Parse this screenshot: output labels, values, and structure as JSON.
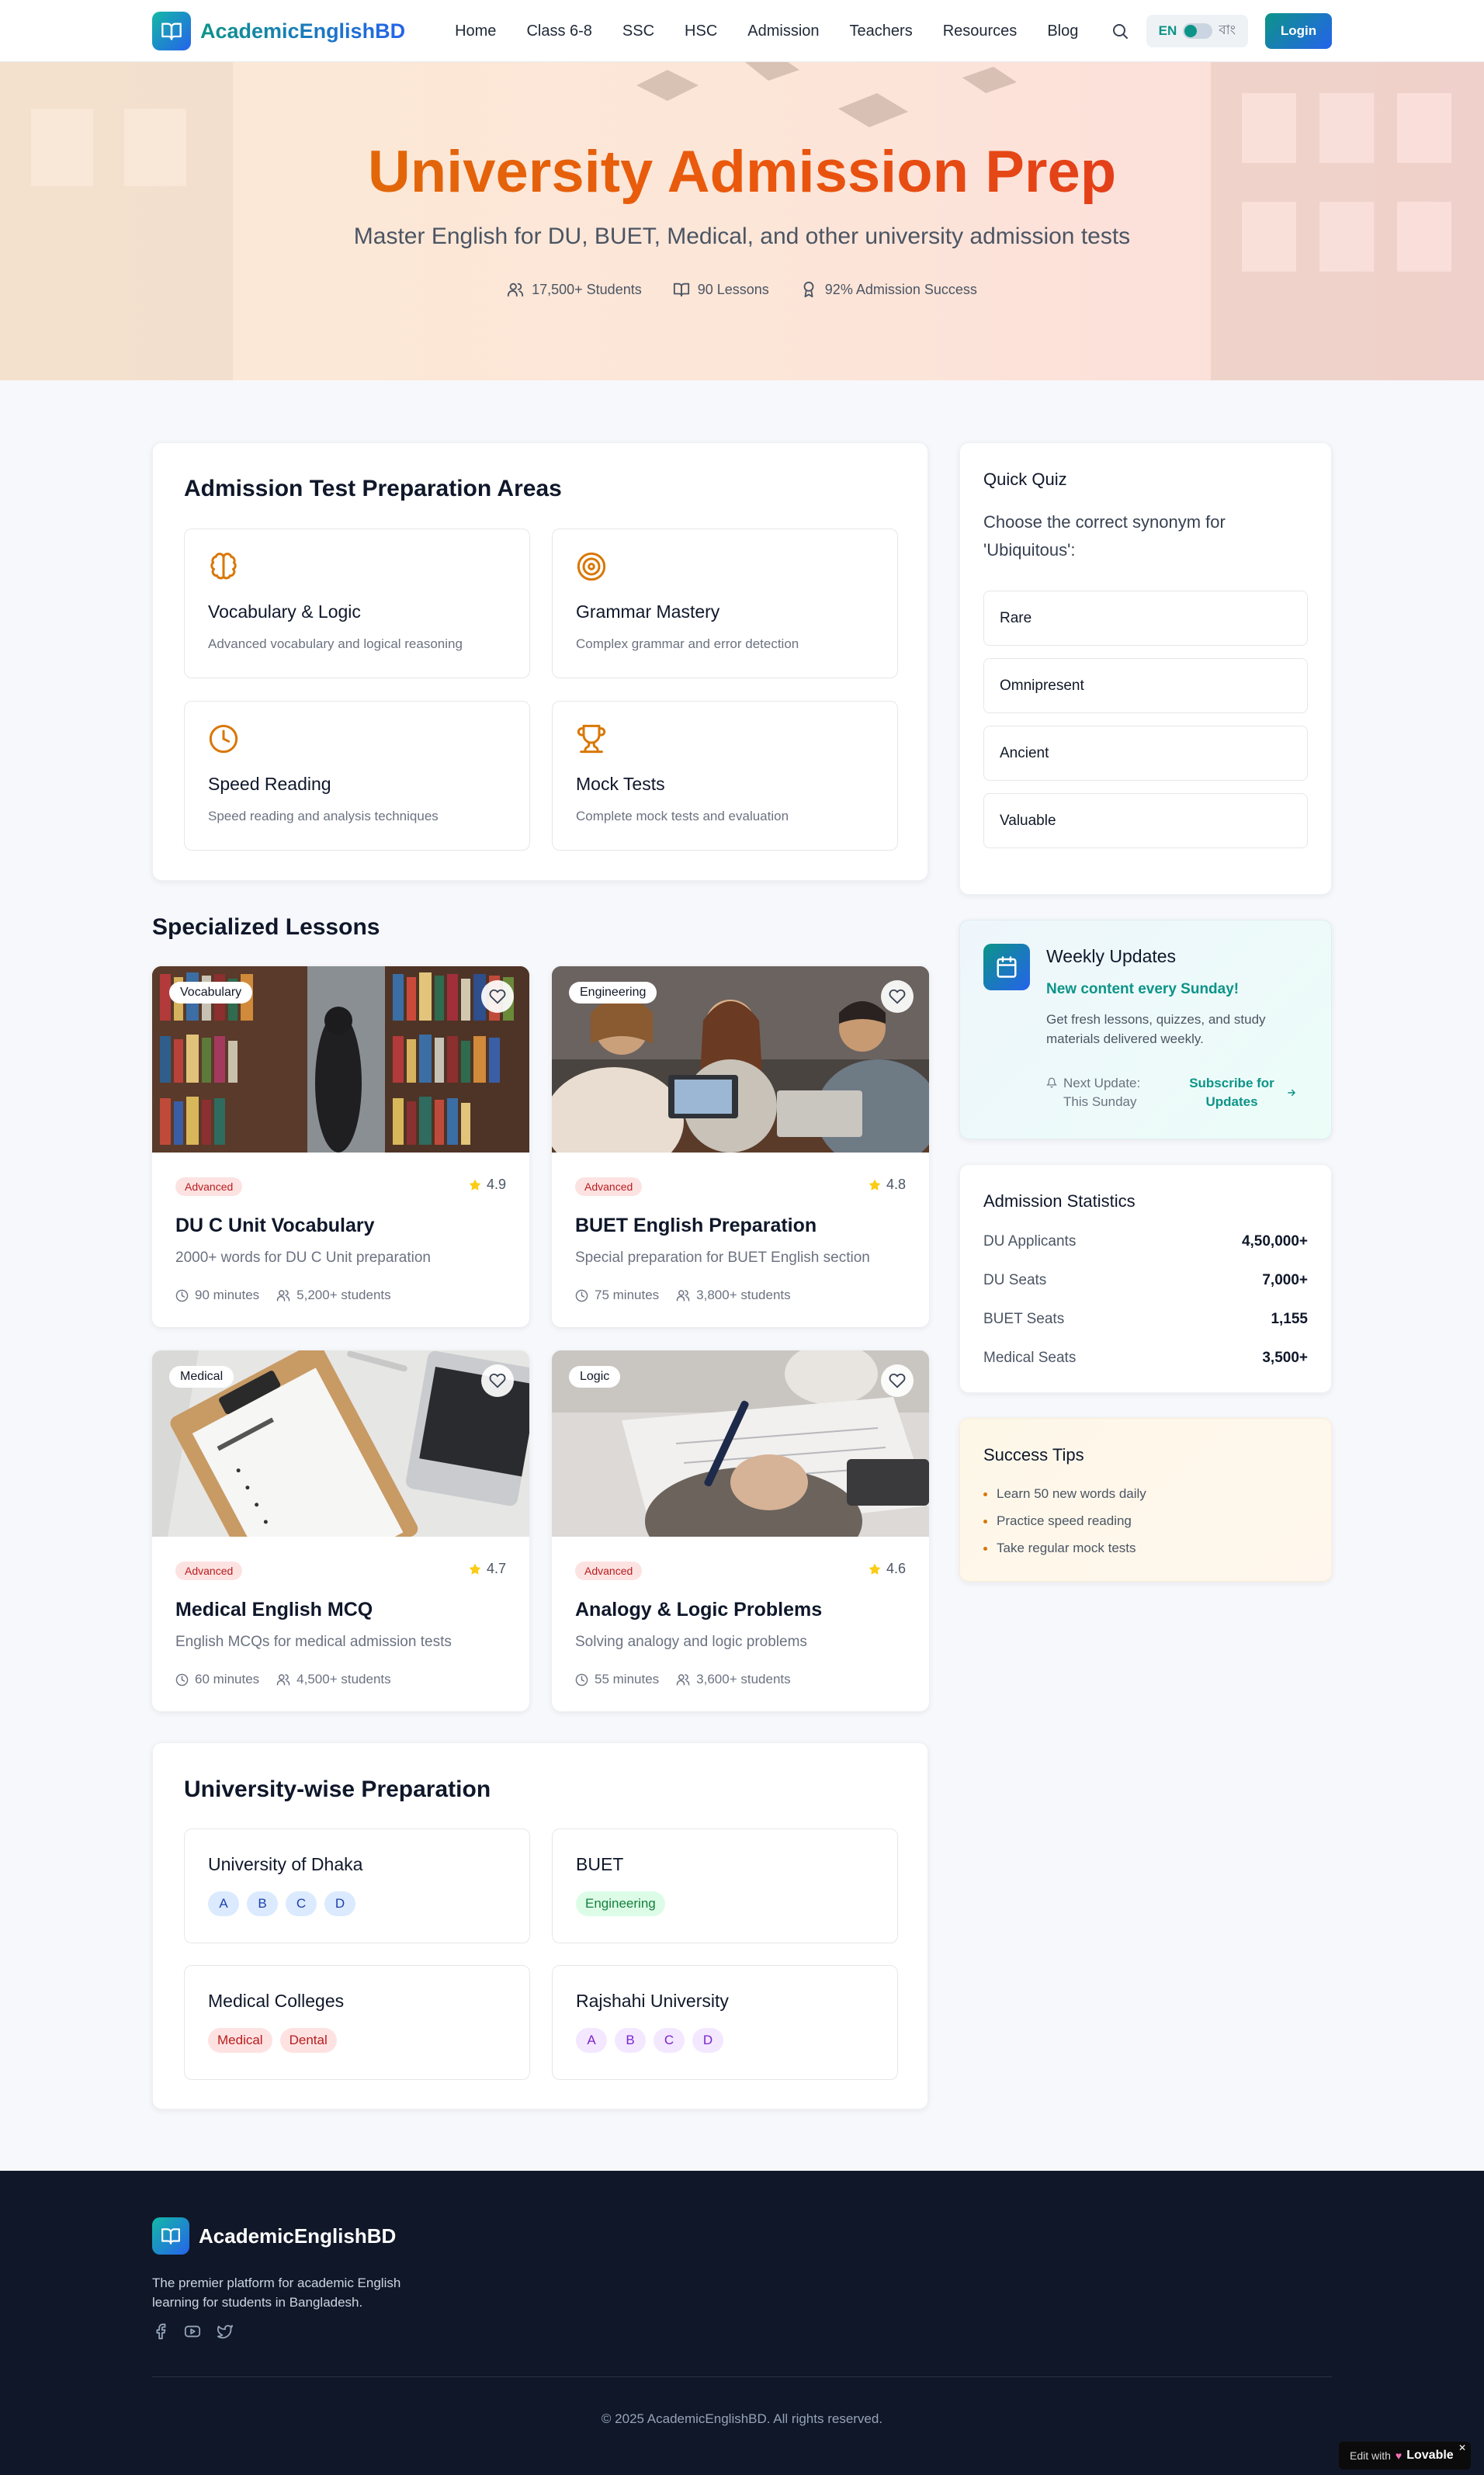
{
  "nav": {
    "brand": "AcademicEnglishBD",
    "links": [
      "Home",
      "Class 6-8",
      "SSC",
      "HSC",
      "Admission",
      "Teachers",
      "Resources",
      "Blog"
    ],
    "lang_en": "EN",
    "lang_bn": "বাং",
    "login": "Login"
  },
  "hero": {
    "title": "University Admission Prep",
    "subtitle": "Master English for DU, BUET, Medical, and other university admission tests",
    "stats": {
      "students": "17,500+ Students",
      "lessons": "90 Lessons",
      "success": "92% Admission Success"
    }
  },
  "areas": {
    "title": "Admission Test Preparation Areas",
    "items": [
      {
        "title": "Vocabulary & Logic",
        "desc": "Advanced vocabulary and logical reasoning",
        "icon": "brain-icon"
      },
      {
        "title": "Grammar Mastery",
        "desc": "Complex grammar and error detection",
        "icon": "target-icon"
      },
      {
        "title": "Speed Reading",
        "desc": "Speed reading and analysis techniques",
        "icon": "clock-icon"
      },
      {
        "title": "Mock Tests",
        "desc": "Complete mock tests and evaluation",
        "icon": "trophy-icon"
      }
    ]
  },
  "lessons": {
    "title": "Specialized Lessons",
    "items": [
      {
        "tag": "Vocabulary",
        "level": "Advanced",
        "rating": "4.9",
        "title": "DU C Unit Vocabulary",
        "desc": "2000+ words for DU C Unit preparation",
        "duration": "90 minutes",
        "students": "5,200+ students"
      },
      {
        "tag": "Engineering",
        "level": "Advanced",
        "rating": "4.8",
        "title": "BUET English Preparation",
        "desc": "Special preparation for BUET English section",
        "duration": "75 minutes",
        "students": "3,800+ students"
      },
      {
        "tag": "Medical",
        "level": "Advanced",
        "rating": "4.7",
        "title": "Medical English MCQ",
        "desc": "English MCQs for medical admission tests",
        "duration": "60 minutes",
        "students": "4,500+ students"
      },
      {
        "tag": "Logic",
        "level": "Advanced",
        "rating": "4.6",
        "title": "Analogy & Logic Problems",
        "desc": "Solving analogy and logic problems",
        "duration": "55 minutes",
        "students": "3,600+ students"
      }
    ]
  },
  "universities": {
    "title": "University-wise Preparation",
    "items": [
      {
        "name": "University of Dhaka",
        "pills": [
          "A",
          "B",
          "C",
          "D"
        ]
      },
      {
        "name": "BUET",
        "pills": [
          "Engineering"
        ]
      },
      {
        "name": "Medical Colleges",
        "pills": [
          "Medical",
          "Dental"
        ]
      },
      {
        "name": "Rajshahi University",
        "pills": [
          "A",
          "B",
          "C",
          "D"
        ]
      }
    ]
  },
  "quiz": {
    "title": "Quick Quiz",
    "question": "Choose the correct synonym for 'Ubiquitous':",
    "options": [
      "Rare",
      "Omnipresent",
      "Ancient",
      "Valuable"
    ]
  },
  "weekly": {
    "title": "Weekly Updates",
    "headline": "New content every Sunday!",
    "desc": "Get fresh lessons, quizzes, and study materials delivered weekly.",
    "next_label": "Next Update:",
    "next_value": "This Sunday",
    "subscribe": "Subscribe for Updates"
  },
  "stats": {
    "title": "Admission Statistics",
    "rows": [
      {
        "label": "DU Applicants",
        "value": "4,50,000+"
      },
      {
        "label": "DU Seats",
        "value": "7,000+"
      },
      {
        "label": "BUET Seats",
        "value": "1,155"
      },
      {
        "label": "Medical Seats",
        "value": "3,500+"
      }
    ]
  },
  "tips": {
    "title": "Success Tips",
    "items": [
      "Learn 50 new words daily",
      "Practice speed reading",
      "Take regular mock tests"
    ]
  },
  "footer": {
    "brand": "AcademicEnglishBD",
    "desc": "The premier platform for academic English learning for students in Bangladesh.",
    "copyright": "© 2025 AcademicEnglishBD. All rights reserved."
  },
  "badge": {
    "edit": "Edit with",
    "brand": "Lovable"
  },
  "colors": {
    "brand_teal": "#0d9488",
    "brand_blue": "#2563eb",
    "accent_amber": "#d97706",
    "accent_red": "#dc2626",
    "footer_bg": "#101728"
  }
}
